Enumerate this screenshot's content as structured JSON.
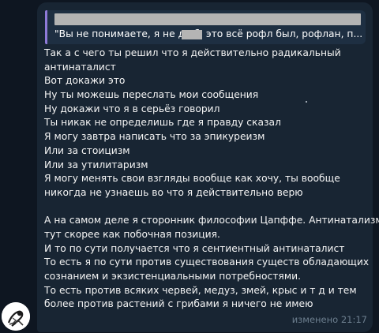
{
  "message": {
    "reply_quote": {
      "text": "\"Вы не понимаете, я не до        б, это всё рофл был, рофлан, п..."
    },
    "lines": [
      "Так а с чего ты решил что я действительно радикальный",
      "антинаталист",
      "Вот докажи это",
      "Ну ты можешь переслать мои сообщения",
      "Ну докажи что я в серьёз говорил",
      "Ты никак не определишь где я правду сказал",
      "Я могу завтра написать что за эпикуреизм",
      "Или за стоицизм",
      "Или за утилитаризм",
      "Я могу менять свои взгляды вообще как хочу, ты вообще",
      "никогда не узнаешь во что я действительно верю",
      "",
      "А на самом деле я сторонник философии Цапффе. Антинатализм",
      "тут скорее как побочная позиция.",
      "И то по сути получается что я сентиентный антинаталист",
      "То есть я по сути против существования существ обладающих",
      "сознанием и экзистенциальными потребностями.",
      "То есть против всяких червей, медуз, змей, крыс и т д и тем",
      "более против растений с грибами я ничего не имею"
    ],
    "edited_label": "изменено",
    "time": "21:17"
  },
  "colors": {
    "background": "#0e1621",
    "bubble": "#182533",
    "quote_accent": "#8f7ad8",
    "meta_text": "#6d7f8f"
  },
  "icons": {
    "avatar": "sender-avatar-sketch"
  }
}
